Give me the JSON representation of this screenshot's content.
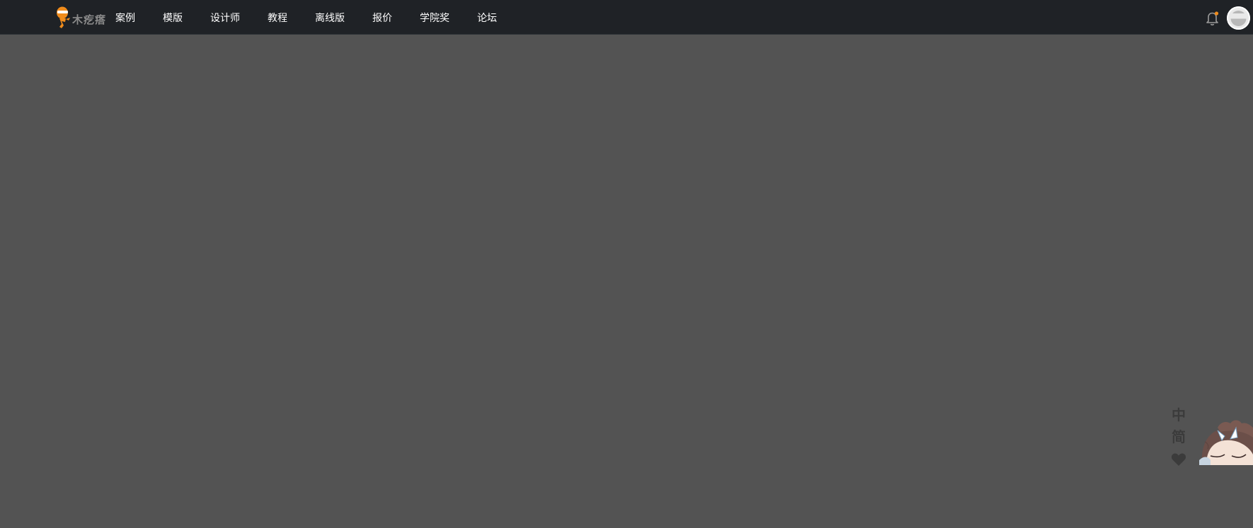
{
  "header": {
    "logo_text": "木疙瘩",
    "nav": [
      {
        "label": "案例"
      },
      {
        "label": "模版"
      },
      {
        "label": "设计师"
      },
      {
        "label": "教程"
      },
      {
        "label": "离线版"
      },
      {
        "label": "报价"
      },
      {
        "label": "学院奖"
      },
      {
        "label": "论坛"
      }
    ],
    "notification_icon": "bell-icon",
    "avatar_icon": "default-avatar"
  },
  "side_tools": {
    "lang_cn": "中",
    "lang_simplified": "简",
    "favorite_icon": "heart-icon"
  },
  "colors": {
    "page_bg": "#535353",
    "header_bg": "#1f2226",
    "accent": "#f08c1c"
  }
}
